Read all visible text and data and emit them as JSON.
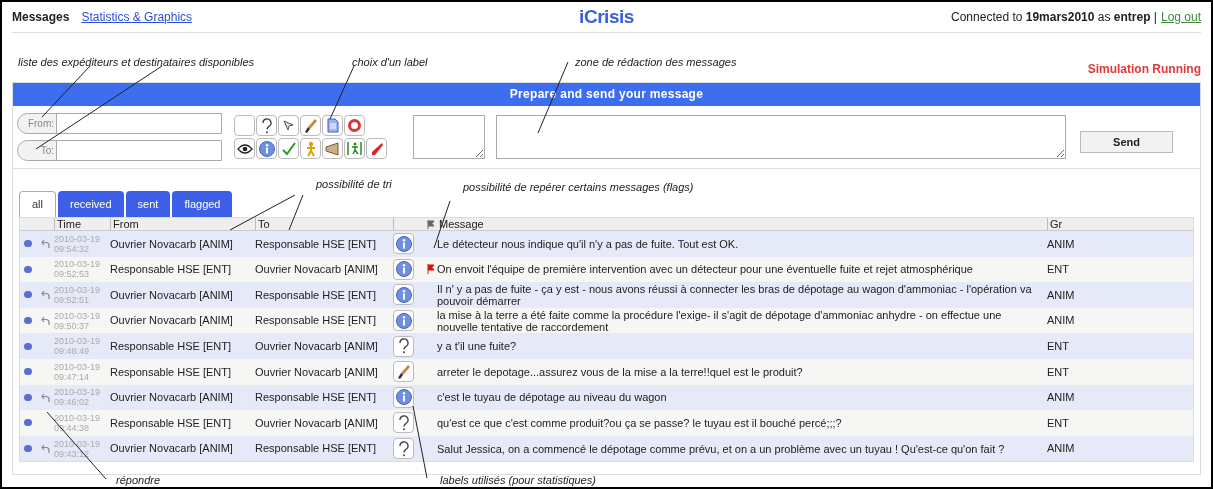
{
  "header": {
    "nav": [
      {
        "label": "Messages",
        "selected": true
      },
      {
        "label": "Statistics & Graphics",
        "selected": false
      }
    ],
    "title": "iCrisis",
    "connection": "Connected to **19mars2010** as **entrep** |",
    "logout": "Log out"
  },
  "annotations": {
    "senders": "liste des expéditeurs et destinataires disponibles",
    "label_choice": "choix d'un label",
    "compose_zone": "zone de rédaction des messages",
    "sorting": "possibilité de tri",
    "flags": "possibilité de repérer certains messages (flags)",
    "reply": "répondre",
    "labels_used": "labels utilisés (pour statistiques)"
  },
  "status": "Simulation Running",
  "compose": {
    "title": "Prepare and send your message",
    "from_label": "From:",
    "to_label": "To:",
    "send": "Send"
  },
  "tabs": [
    {
      "label": "all",
      "selected": true
    },
    {
      "label": "received",
      "selected": false
    },
    {
      "label": "sent",
      "selected": false
    },
    {
      "label": "flagged",
      "selected": false
    }
  ],
  "table": {
    "columns": {
      "time": "Time",
      "from": "From",
      "to": "To",
      "message": "Message",
      "group": "Gr"
    },
    "rows": [
      {
        "reply": true,
        "date": "2010-03-19",
        "time": "09:54:32",
        "from": "Ouvrier Novacarb [ANIM]",
        "to": "Responsable HSE [ENT]",
        "kind": "info",
        "flagged": false,
        "message": "Le détecteur nous indique qu'il n'y a pas de fuite. Tout est OK.",
        "group": "ANIM"
      },
      {
        "reply": false,
        "date": "2010-03-19",
        "time": "09:52:53",
        "from": "Responsable HSE [ENT]",
        "to": "Ouvrier Novacarb [ANIM]",
        "kind": "info",
        "flagged": true,
        "message": "On envoit l'équipe de première intervention avec un détecteur pour une éventuelle fuite et rejet atmosphérique",
        "group": "ENT"
      },
      {
        "reply": true,
        "date": "2010-03-19",
        "time": "09:52:51",
        "from": "Ouvrier Novacarb [ANIM]",
        "to": "Responsable HSE [ENT]",
        "kind": "info",
        "flagged": false,
        "message": "Il n' y a pas de fuite - ça y est - nous avons réussi à connecter les bras de dépotage au wagon d'ammoniac - l'opération va pouvoir démarrer",
        "group": "ANIM"
      },
      {
        "reply": true,
        "date": "2010-03-19",
        "time": "09:50:37",
        "from": "Ouvrier Novacarb [ANIM]",
        "to": "Responsable HSE [ENT]",
        "kind": "info",
        "flagged": false,
        "message": "la mise à la terre a été faite comme la procédure l'exige- il s'agit de dépotage d'ammoniac anhydre - on effectue une nouvelle tentative de raccordement",
        "group": "ANIM"
      },
      {
        "reply": false,
        "date": "2010-03-19",
        "time": "09:48:49",
        "from": "Responsable HSE [ENT]",
        "to": "Ouvrier Novacarb [ANIM]",
        "kind": "question",
        "flagged": false,
        "message": "y a t'il une fuite?",
        "group": "ENT"
      },
      {
        "reply": false,
        "date": "2010-03-19",
        "time": "09:47:14",
        "from": "Responsable HSE [ENT]",
        "to": "Ouvrier Novacarb [ANIM]",
        "kind": "brush",
        "flagged": false,
        "message": "arreter le depotage...assurez vous de la mise a la terre!!quel est le produit?",
        "group": "ENT"
      },
      {
        "reply": true,
        "date": "2010-03-19",
        "time": "09:46:02",
        "from": "Ouvrier Novacarb [ANIM]",
        "to": "Responsable HSE [ENT]",
        "kind": "info",
        "flagged": false,
        "message": "c'est le tuyau de dépotage au niveau du wagon",
        "group": "ANIM"
      },
      {
        "reply": false,
        "date": "2010-03-19",
        "time": "09:44:38",
        "from": "Responsable HSE [ENT]",
        "to": "Ouvrier Novacarb [ANIM]",
        "kind": "question",
        "flagged": false,
        "message": "qu'est ce que c'est comme produit?ou ça se passe? le tuyau est il bouché percé;;;?",
        "group": "ENT"
      },
      {
        "reply": true,
        "date": "2010-03-19",
        "time": "09:43:12",
        "from": "Ouvrier Novacarb [ANIM]",
        "to": "Responsable HSE [ENT]",
        "kind": "question",
        "flagged": false,
        "message": "Salut Jessica, on a commencé le dépotage comme prévu, et on a un problème avec un tuyau ! Qu'est-ce qu'on fait ?",
        "group": "ANIM"
      }
    ]
  }
}
